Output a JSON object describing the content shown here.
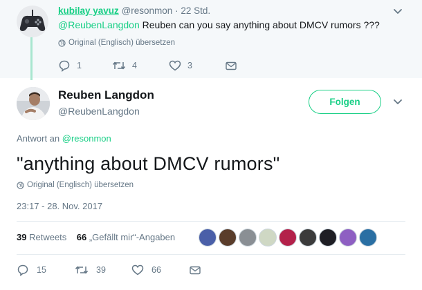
{
  "parent_tweet": {
    "display_name": "kubilay yavuz",
    "handle": "@resonmon",
    "time": "· 22 Std.",
    "mention": "@ReubenLangdon",
    "text": " Reuben can you say anything about DMCV rumors ???",
    "translate": "Original (Englisch) übersetzen",
    "replies": "1",
    "retweets": "4",
    "likes": "3"
  },
  "main_tweet": {
    "display_name": "Reuben Langdon",
    "handle": "@ReubenLangdon",
    "follow_label": "Folgen",
    "reply_to_prefix": "Antwort an ",
    "reply_to_handle": "@resonmon",
    "text": "\"anything about DMCV rumors\"",
    "translate": "Original (Englisch) übersetzen",
    "timestamp": "23:17 - 28. Nov. 2017",
    "retweet_count": "39",
    "retweet_label": "Retweets",
    "like_count": "66",
    "like_label": "„Gefällt mir“-Angaben",
    "replies": "15",
    "retweets": "39",
    "likes": "66"
  },
  "colors": {
    "accent": "#19cf86",
    "muted": "#657786",
    "background_parent": "#f5f8fa"
  },
  "likers": [
    {
      "icon": "avatar-liker-1",
      "color": "#4a5fa8"
    },
    {
      "icon": "avatar-liker-2",
      "color": "#5a3d2b"
    },
    {
      "icon": "avatar-liker-3",
      "color": "#8a8f94"
    },
    {
      "icon": "avatar-liker-4",
      "color": "#cfd8c4"
    },
    {
      "icon": "avatar-liker-5",
      "color": "#b3214a"
    },
    {
      "icon": "avatar-liker-6",
      "color": "#3b3b3b"
    },
    {
      "icon": "avatar-liker-7",
      "color": "#1e1e24"
    },
    {
      "icon": "avatar-liker-8",
      "color": "#8e5fc2"
    },
    {
      "icon": "avatar-liker-9",
      "color": "#2a6fa3"
    }
  ]
}
